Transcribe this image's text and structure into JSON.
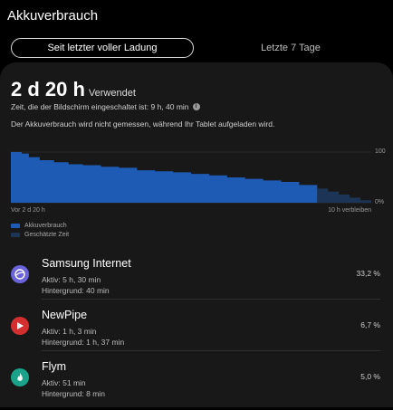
{
  "header": {
    "title": "Akkuverbrauch"
  },
  "tabs": [
    {
      "label": "Seit letzter voller Ladung",
      "selected": true
    },
    {
      "label": "Letzte 7 Tage",
      "selected": false
    }
  ],
  "summary": {
    "usage_value": "2 d 20 h",
    "usage_label": "Verwendet",
    "screen_time": "Zeit, die der Bildschirm eingeschaltet ist: 9 h, 40 min",
    "info_glyph": "i",
    "notice": "Der Akkuverbrauch wird nicht gemessen, während Ihr Tablet aufgeladen wird."
  },
  "chart_data": {
    "type": "area",
    "x_start_label": "Vor 2 d 20 h",
    "x_end_label": "10 h verbleiben",
    "y_ticks": [
      "100",
      "0%"
    ],
    "ylim": [
      0,
      100
    ],
    "series": [
      {
        "name": "Akkuverbrauch",
        "x": [
          0,
          3,
          5,
          8,
          12,
          16,
          20,
          25,
          30,
          35,
          40,
          45,
          50,
          55,
          60,
          65,
          70,
          75,
          80,
          85
        ],
        "values": [
          100,
          97,
          90,
          84,
          80,
          76,
          74,
          71,
          69,
          64,
          62,
          60,
          57,
          54,
          50,
          47,
          44,
          41,
          35,
          28
        ],
        "color": "#1e5bb5"
      },
      {
        "name": "Geschätzte Zeit",
        "x": [
          85,
          88,
          91,
          94,
          97,
          100
        ],
        "values": [
          28,
          22,
          16,
          10,
          5,
          0
        ],
        "color": "#1c3557"
      }
    ]
  },
  "legend": {
    "items": [
      {
        "label": "Akkuverbrauch",
        "color": "#1e5bb5"
      },
      {
        "label": "Geschätzte Zeit",
        "color": "#1c3557"
      }
    ]
  },
  "apps": [
    {
      "name": "Samsung Internet",
      "active": "Aktiv: 5 h, 30 min",
      "background": "Hintergrund: 40 min",
      "percent": "33,2 %",
      "icon": "samsung-internet-icon",
      "icon_color": "#6b63d9"
    },
    {
      "name": "NewPipe",
      "active": "Aktiv: 1 h, 3 min",
      "background": "Hintergrund: 1 h, 37 min",
      "percent": "6,7 %",
      "icon": "newpipe-icon",
      "icon_color": "#d32f2f"
    },
    {
      "name": "Flym",
      "active": "Aktiv: 51 min",
      "background": "Hintergrund: 8 min",
      "percent": "5,0 %",
      "icon": "flym-icon",
      "icon_color": "#1aa38a"
    }
  ]
}
